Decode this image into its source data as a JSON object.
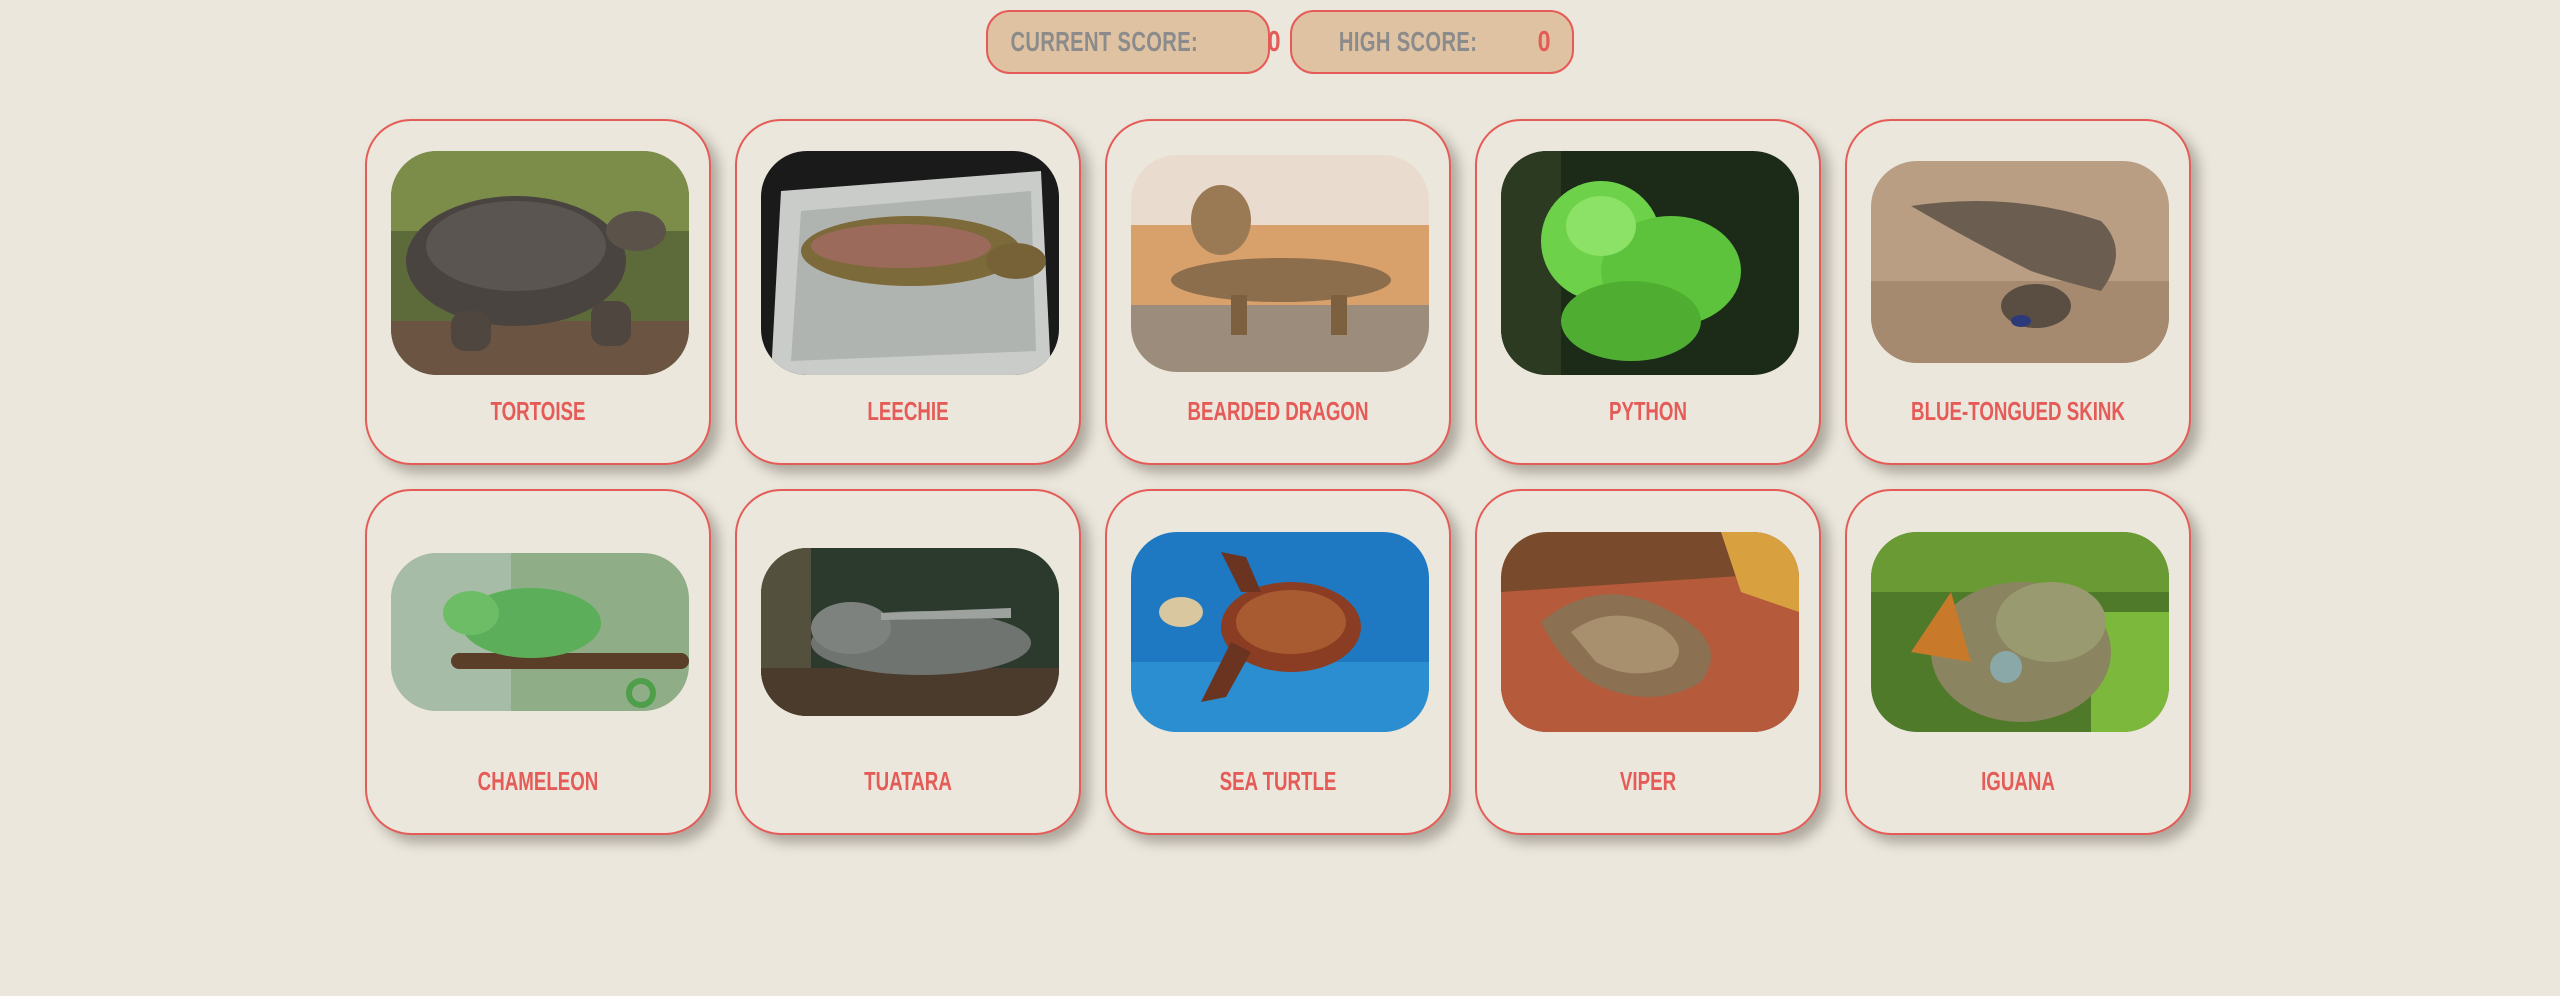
{
  "scoreboard": {
    "current_label": "CURRENT SCORE:",
    "current_value": "0",
    "high_label": "HIGH SCORE:",
    "high_value": "0"
  },
  "colors": {
    "background": "#ebe7dc",
    "accent": "#e55b57",
    "pill_fill": "#dfc2a2",
    "label_gray": "#8b8b8b"
  },
  "cards": [
    {
      "name": "TORTOISE",
      "image": "tortoise-photo"
    },
    {
      "name": "LEECHIE",
      "image": "leachie-gecko-photo"
    },
    {
      "name": "BEARDED DRAGON",
      "image": "bearded-dragon-photo"
    },
    {
      "name": "PYTHON",
      "image": "green-python-photo"
    },
    {
      "name": "BLUE-TONGUED SKINK",
      "image": "blue-tongued-skink-photo"
    },
    {
      "name": "CHAMELEON",
      "image": "chameleon-photo"
    },
    {
      "name": "TUATARA",
      "image": "tuatara-photo"
    },
    {
      "name": "SEA TURTLE",
      "image": "sea-turtle-photo"
    },
    {
      "name": "VIPER",
      "image": "viper-photo"
    },
    {
      "name": "IGUANA",
      "image": "iguana-photo"
    }
  ]
}
